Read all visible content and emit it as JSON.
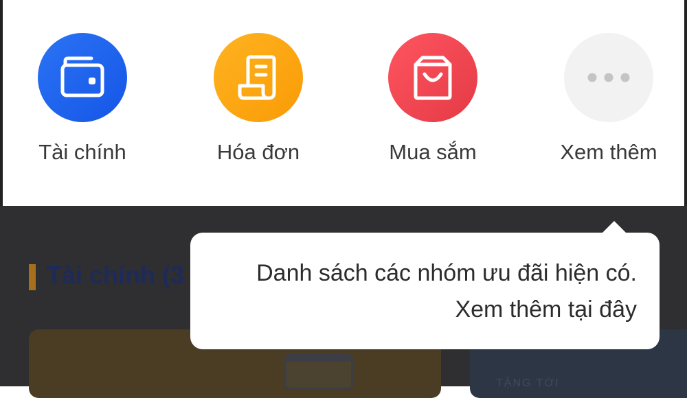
{
  "categories": [
    {
      "label": "Tài chính",
      "icon": "wallet-icon",
      "color": "#1f63ee"
    },
    {
      "label": "Hóa đơn",
      "icon": "receipt-icon",
      "color": "#fca813"
    },
    {
      "label": "Mua sắm",
      "icon": "shopping-bag-icon",
      "color": "#ed4450"
    },
    {
      "label": "Xem thêm",
      "icon": "more-dots-icon",
      "color": "#f2f2f2"
    }
  ],
  "section": {
    "title": "Tài chính (3"
  },
  "tooltip": {
    "line1": "Danh sách các nhóm ưu đãi hiện có.",
    "line2": "Xem thêm tại đây"
  },
  "card_right": {
    "text": "TẶNG TỚI"
  }
}
